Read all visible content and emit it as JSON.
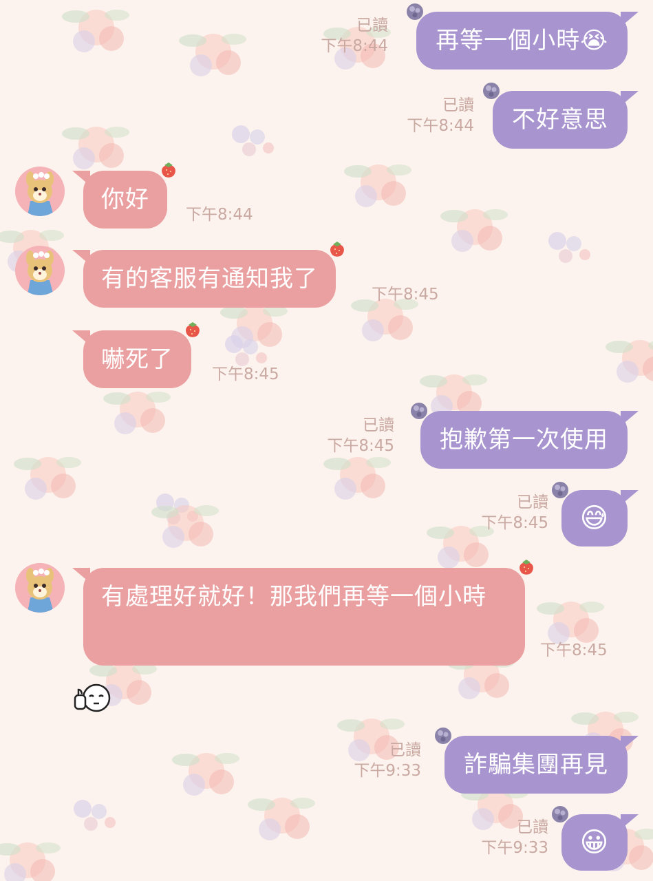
{
  "colors": {
    "background": "#fdf3ee",
    "sent_bubble": "#a895cf",
    "received_bubble": "#eaa0a0",
    "meta_text": "#c9a9a2"
  },
  "messages": [
    {
      "side": "sent",
      "text": "再等一個小時😭",
      "read": "已讀",
      "time": "下午8:44"
    },
    {
      "side": "sent",
      "text": "不好意思",
      "read": "已讀",
      "time": "下午8:44"
    },
    {
      "side": "received",
      "text": "你好",
      "time": "下午8:44",
      "avatar": "cartoon-chipmunk-avatar"
    },
    {
      "side": "received",
      "text": "有的客服有通知我了",
      "time": "下午8:45",
      "avatar": "cartoon-chipmunk-avatar"
    },
    {
      "side": "received",
      "text": "嚇死了",
      "time": "下午8:45"
    },
    {
      "side": "sent",
      "text": "抱歉第一次使用",
      "read": "已讀",
      "time": "下午8:45"
    },
    {
      "side": "sent",
      "text": "😅",
      "read": "已讀",
      "time": "下午8:45"
    },
    {
      "side": "received",
      "text": "有處理好就好！那我們再等一個小時",
      "time": "下午8:45",
      "avatar": "cartoon-chipmunk-avatar",
      "reaction": "thumbs-up-face-sticker"
    },
    {
      "side": "sent",
      "text": "詐騙集團再見",
      "read": "已讀",
      "time": "下午9:33"
    },
    {
      "side": "sent",
      "text": "😀",
      "read": "已讀",
      "time": "下午9:33"
    }
  ]
}
